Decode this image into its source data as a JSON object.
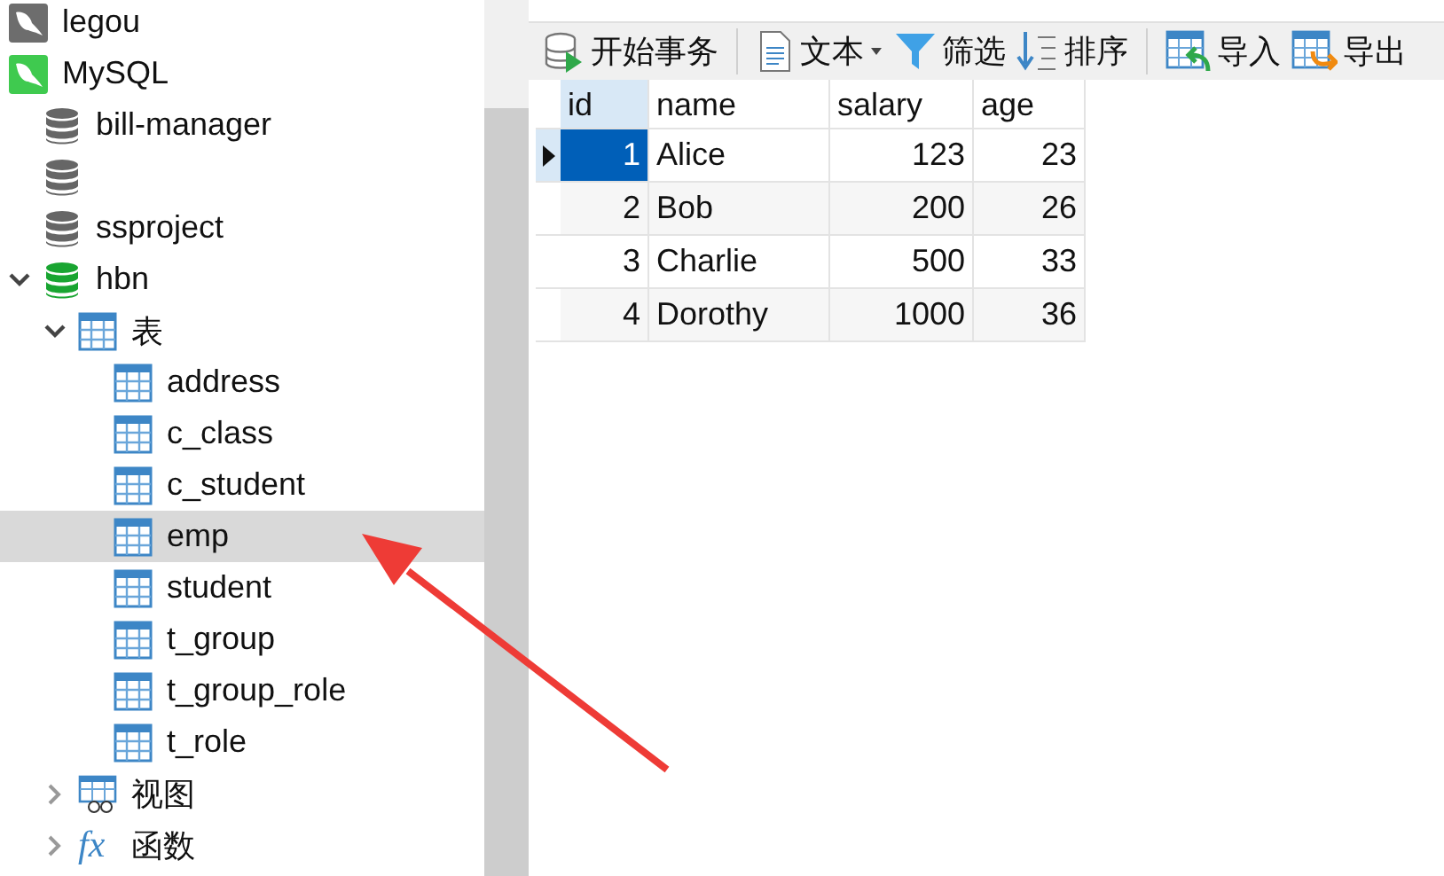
{
  "tree": [
    {
      "label": "legou",
      "kind": "connection",
      "active": false
    },
    {
      "label": "MySQL",
      "kind": "connection",
      "active": true,
      "children": [
        {
          "label": "bill-manager",
          "kind": "database",
          "open": false
        },
        {
          "kind": "database",
          "open": false
        },
        {
          "label": "ssproject",
          "kind": "database",
          "open": false
        },
        {
          "label": "hbn",
          "kind": "database",
          "open": true,
          "expanded": true,
          "children": [
            {
              "label": "表",
              "kind": "tables",
              "expanded": true,
              "children": [
                {
                  "label": "address",
                  "kind": "table",
                  "selected": false
                },
                {
                  "label": "c_class",
                  "kind": "table",
                  "selected": false
                },
                {
                  "label": "c_student",
                  "kind": "table",
                  "selected": false
                },
                {
                  "label": "emp",
                  "kind": "table",
                  "selected": true
                },
                {
                  "label": "student",
                  "kind": "table",
                  "selected": false
                },
                {
                  "label": "t_group",
                  "kind": "table",
                  "selected": false
                },
                {
                  "label": "t_group_role",
                  "kind": "table",
                  "selected": false
                },
                {
                  "label": "t_role",
                  "kind": "table",
                  "selected": false
                }
              ]
            },
            {
              "label": "视图",
              "kind": "views",
              "expanded": false
            },
            {
              "label": "函数",
              "kind": "functions",
              "icon_text": "fx",
              "expanded": false
            }
          ]
        }
      ]
    }
  ],
  "toolbar": [
    {
      "label": "开始事务",
      "kind": "transaction"
    },
    {
      "kind": "separator"
    },
    {
      "label": "文本",
      "kind": "text",
      "dropdown": true
    },
    {
      "label": "筛选",
      "kind": "filter"
    },
    {
      "label": "排序",
      "kind": "sort"
    },
    {
      "kind": "separator"
    },
    {
      "label": "导入",
      "kind": "import"
    },
    {
      "label": "导出",
      "kind": "export"
    }
  ],
  "table": {
    "columns": [
      {
        "label": "id",
        "selected": true
      },
      {
        "label": "name",
        "selected": false
      },
      {
        "label": "salary",
        "selected": false
      },
      {
        "label": "age",
        "selected": false
      }
    ],
    "rows": [
      {
        "selected": true,
        "cells": [
          "1",
          "Alice",
          "123",
          "23"
        ]
      },
      {
        "selected": false,
        "cells": [
          "2",
          "Bob",
          "200",
          "26"
        ]
      },
      {
        "selected": false,
        "cells": [
          "3",
          "Charlie",
          "500",
          "33"
        ]
      },
      {
        "selected": false,
        "cells": [
          "4",
          "Dorothy",
          "1000",
          "36"
        ]
      }
    ]
  },
  "annotation": {
    "kind": "arrow",
    "color": "#ee3b36"
  }
}
